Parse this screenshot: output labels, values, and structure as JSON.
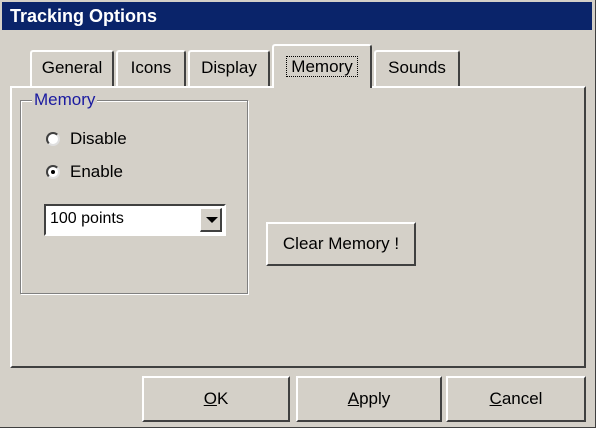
{
  "window": {
    "title": "Tracking Options"
  },
  "tabs": [
    {
      "label": "General"
    },
    {
      "label": "Icons"
    },
    {
      "label": "Display"
    },
    {
      "label": "Memory",
      "active": true
    },
    {
      "label": "Sounds"
    }
  ],
  "memory_group": {
    "legend": "Memory",
    "options": [
      {
        "label": "Disable",
        "selected": false
      },
      {
        "label": "Enable",
        "selected": true
      }
    ],
    "points_select": {
      "value": "100 points"
    },
    "clear_button": "Clear Memory !"
  },
  "footer": {
    "ok": {
      "mnemonic": "O",
      "rest": "K"
    },
    "apply": {
      "mnemonic": "A",
      "rest": "pply"
    },
    "cancel": {
      "mnemonic": "C",
      "rest": "ancel"
    }
  }
}
